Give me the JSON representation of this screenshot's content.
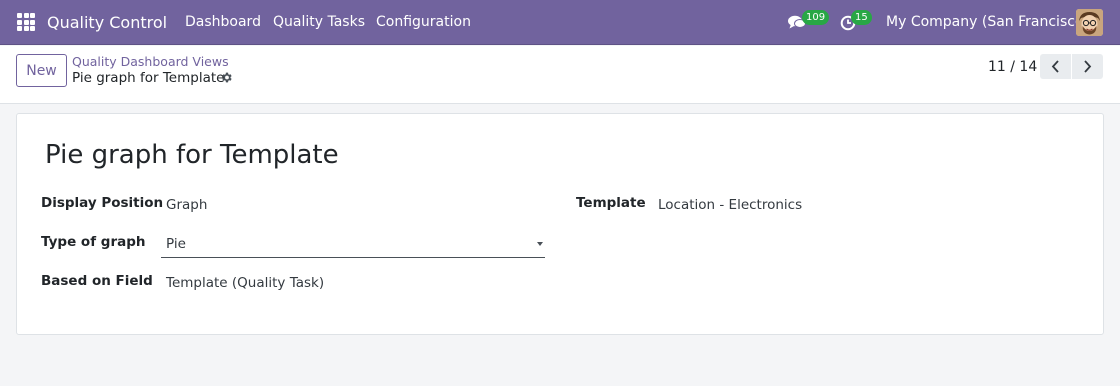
{
  "navbar": {
    "app_name": "Quality Control",
    "menu": [
      "Dashboard",
      "Quality Tasks",
      "Configuration"
    ],
    "messages_count": "109",
    "activities_count": "15",
    "company": "My Company (San Francisco)",
    "icons": [
      "apps-grid-icon",
      "chat-icon",
      "clock-icon",
      "avatar"
    ],
    "bar_color": "#71639e",
    "badge_color": "#28a745"
  },
  "control_panel": {
    "new_label": "New",
    "breadcrumb_parent": "Quality Dashboard Views",
    "breadcrumb_current": "Pie graph for Template",
    "pager": "11 / 14"
  },
  "form": {
    "title": "Pie graph for Template",
    "fields": {
      "display_position": {
        "label": "Display Position",
        "value": "Graph"
      },
      "type_of_graph": {
        "label": "Type of graph",
        "value": "Pie"
      },
      "based_on_field": {
        "label": "Based on Field",
        "value": "Template (Quality Task)"
      },
      "template": {
        "label": "Template",
        "value": "Location - Electronics"
      }
    }
  }
}
